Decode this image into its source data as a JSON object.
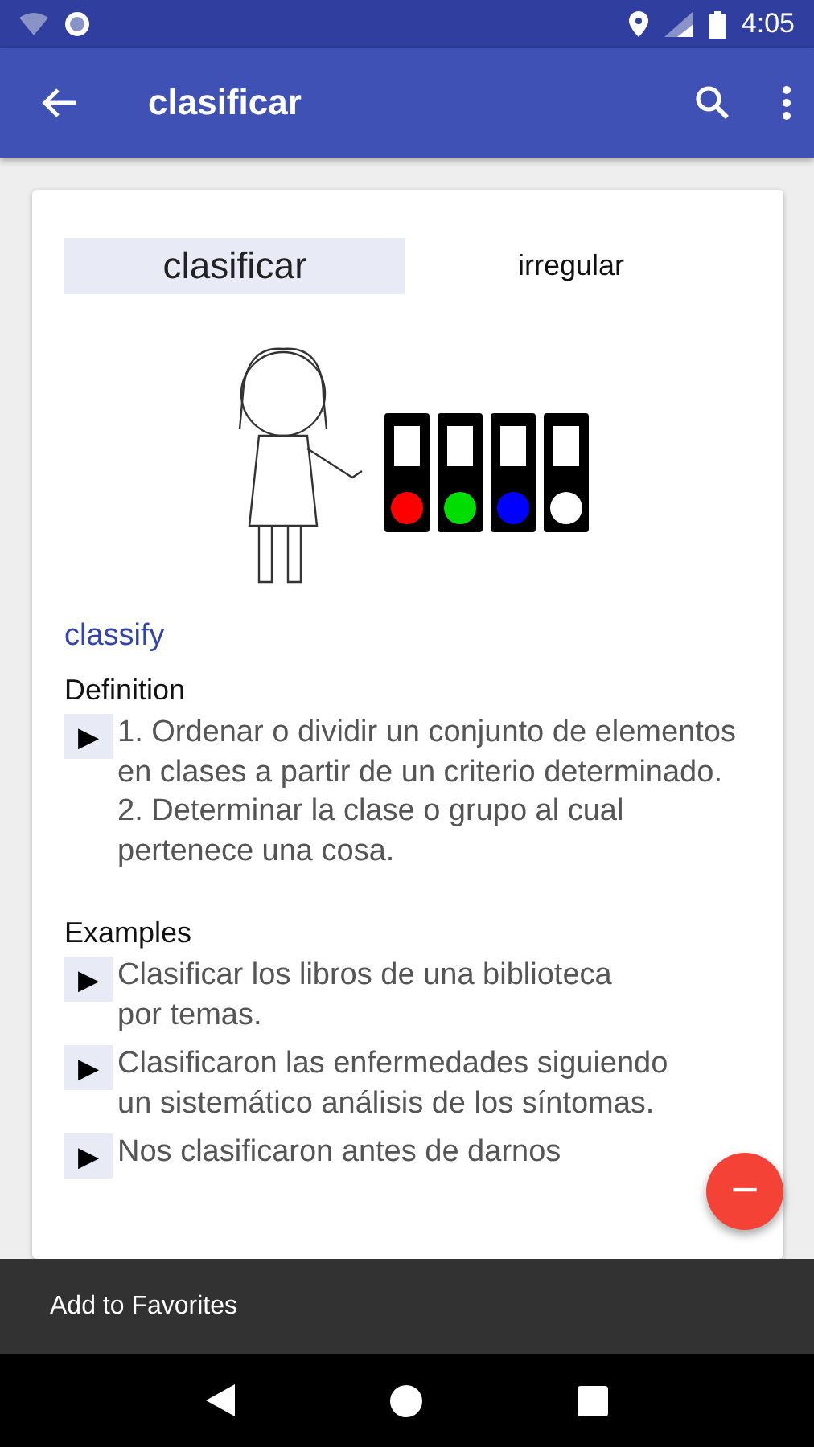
{
  "status_bar": {
    "time": "4:05"
  },
  "app_bar": {
    "title": "clasificar"
  },
  "entry": {
    "headword": "clasificar",
    "tag": "irregular",
    "translation": "classify",
    "sections": [
      {
        "heading": "Definition",
        "items": [
          {
            "marker": "▶",
            "text": "1. Ordenar o dividir un conjunto de elementos en clases a partir de un criterio determinado.\n2. Determinar la clase o grupo al cual pertenece una cosa."
          }
        ]
      },
      {
        "heading": "Examples",
        "items": [
          {
            "marker": "▶",
            "text": "Clasificar los libros de una biblioteca\npor temas."
          },
          {
            "marker": "▶",
            "text": "Clasificaron las enfermedades siguiendo\nun sistemático análisis de los síntomas."
          },
          {
            "marker": "▶",
            "text": "Nos clasificaron antes de darnos"
          }
        ]
      }
    ]
  },
  "fab": {
    "label": "−"
  },
  "snackbar": {
    "message": "Add to Favorites"
  }
}
